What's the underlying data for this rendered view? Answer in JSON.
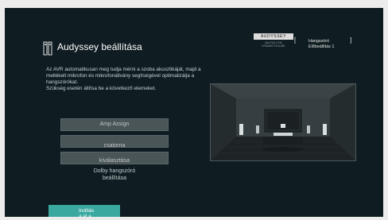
{
  "screen": {
    "title": "Audyssey beállítása",
    "description": "Az AVR automatikusan meg tudja mérni a szoba akusztikáját, majd a mellékelt mikrofon és mikrofonállvány segítségével optimalizálja a hangszórókat.\nSzükség esetén állítsa be a következő elemeket.",
    "icon": "speaker-setup-icon"
  },
  "brand": {
    "logo_text": "AUDYSSEY",
    "logo_subtext": "MULTEQ XT32\nDYNAMIC VOLUME"
  },
  "preset": {
    "bracket_open": "[",
    "bracket_close": "]",
    "label": "Hangszóró\nElőbeállítás 1"
  },
  "menu": {
    "items": [
      {
        "label": "Amp Assign"
      },
      {
        "label": "csatorna"
      },
      {
        "label": "kiválasztása"
      },
      {
        "label": "Dolby hangszóró\nbeállítása"
      }
    ]
  },
  "start_button": {
    "label": "Indítás\na el a\noldalt."
  },
  "colors": {
    "background": "#0f1c21",
    "frame": "#ececec",
    "accent": "#3aa89f",
    "menu_bg": "#4a5558"
  }
}
